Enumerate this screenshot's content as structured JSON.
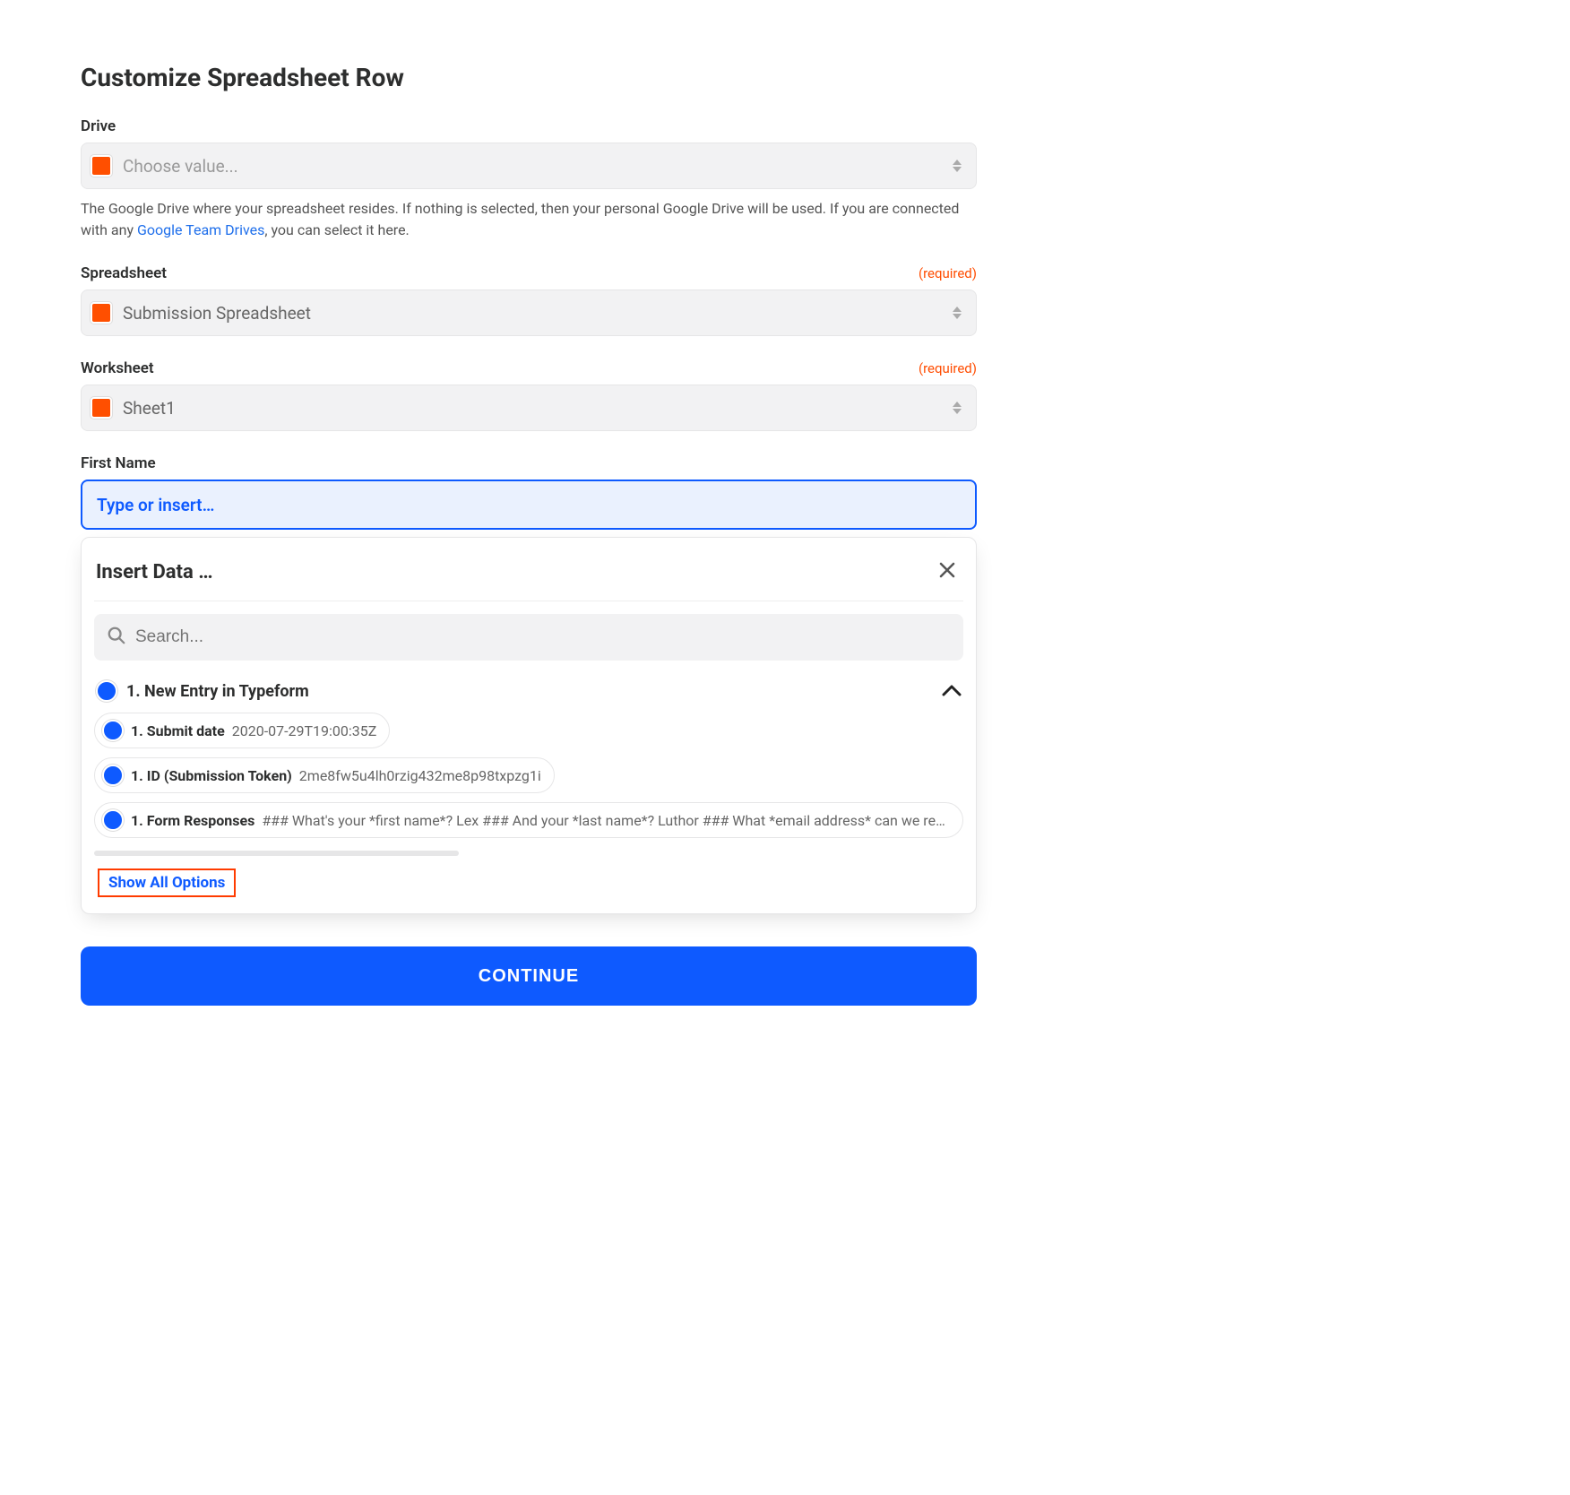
{
  "page": {
    "title": "Customize Spreadsheet Row"
  },
  "fields": {
    "drive": {
      "label": "Drive",
      "placeholder": "Choose value...",
      "help_pre": "The Google Drive where your spreadsheet resides. If nothing is selected, then your personal Google Drive will be used. If you are connected with any ",
      "help_link": "Google Team Drives",
      "help_post": ", you can select it here."
    },
    "spreadsheet": {
      "label": "Spreadsheet",
      "required": "(required)",
      "value": "Submission Spreadsheet"
    },
    "worksheet": {
      "label": "Worksheet",
      "required": "(required)",
      "value": "Sheet1"
    },
    "first_name": {
      "label": "First Name",
      "placeholder": "Type or insert…"
    }
  },
  "dropdown": {
    "title": "Insert Data …",
    "search_placeholder": "Search...",
    "group_title": "1. New Entry in Typeform",
    "options": [
      {
        "label": "1. Submit date",
        "value": "2020-07-29T19:00:35Z"
      },
      {
        "label": "1. ID (Submission Token)",
        "value": "2me8fw5u4lh0rzig432me8p98txpzg1i"
      },
      {
        "label": "1. Form Responses",
        "value": "### What's your *first name*? Lex ### And your *last name*? Luthor ### What *email address* can we reach yo"
      }
    ],
    "show_all": "Show All Options"
  },
  "actions": {
    "continue": "CONTINUE"
  }
}
